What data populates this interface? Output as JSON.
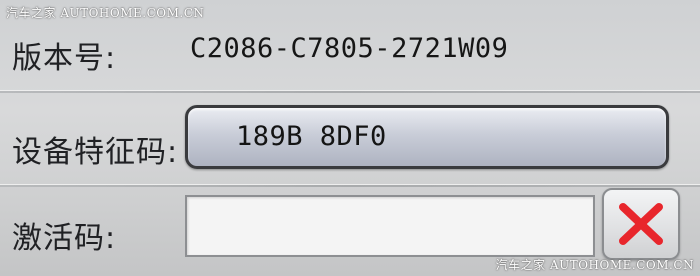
{
  "watermark": {
    "top": "汽车之家 AUTOHOME.COM.CN",
    "bottom": "汽车之家 AUTOHOME.COM.CN"
  },
  "version": {
    "label": "版本号:",
    "value": "C2086-C7805-2721W09"
  },
  "device_code": {
    "label": "设备特征码:",
    "value": "189B 8DF0"
  },
  "activation_code": {
    "label": "激活码:",
    "value": "",
    "placeholder": ""
  },
  "clear_button": {
    "icon": "close-icon",
    "icon_color": "#e8262c"
  }
}
